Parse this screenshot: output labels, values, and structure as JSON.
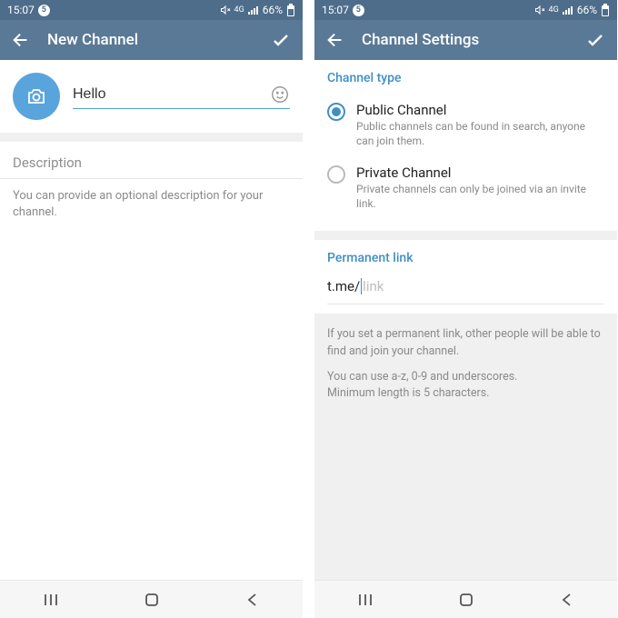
{
  "status": {
    "time": "15:07",
    "badge": "5",
    "battery": "66%"
  },
  "left": {
    "title": "New Channel",
    "nameValue": "Hello",
    "descLabel": "Description",
    "descHint": "You can provide an optional description for your channel."
  },
  "right": {
    "title": "Channel Settings",
    "channelTypeTitle": "Channel type",
    "public": {
      "label": "Public Channel",
      "desc": "Public channels can be found in search, anyone can join them."
    },
    "private": {
      "label": "Private Channel",
      "desc": "Private channels can only be joined via an invite link."
    },
    "permanentLinkTitle": "Permanent link",
    "linkPrefix": "t.me/",
    "linkPlaceholder": "link",
    "info1": "If you set a permanent link, other people will be able to find and join your channel.",
    "info2": "You can use a-z, 0-9 and underscores.",
    "info3": "Minimum length is 5 characters."
  }
}
